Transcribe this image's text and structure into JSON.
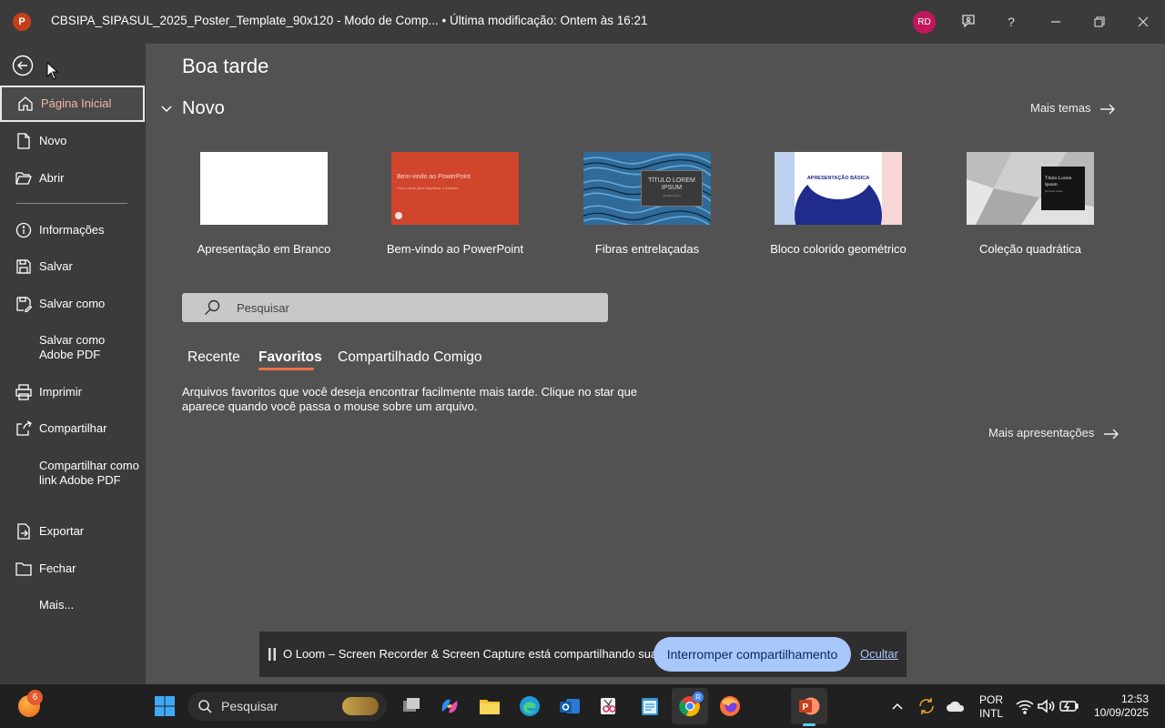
{
  "titlebar": {
    "app_icon_letter": "P",
    "title": "CBSIPA_SIPASUL_2025_Poster_Template_90x120  -  Modo de Comp...  •  Última modificação: Ontem às 16:21",
    "avatar": "RD",
    "help": "?"
  },
  "nav": {
    "items": [
      {
        "label": "Página Inicial",
        "icon": "home-icon"
      },
      {
        "label": "Novo",
        "icon": "new-document-icon"
      },
      {
        "label": "Abrir",
        "icon": "folder-open-icon"
      },
      {
        "label": "Informações",
        "icon": "info-icon"
      },
      {
        "label": "Salvar",
        "icon": "save-icon"
      },
      {
        "label": "Salvar como",
        "icon": "save-as-icon"
      },
      {
        "label": "Salvar como Adobe PDF",
        "icon": ""
      },
      {
        "label": "Imprimir",
        "icon": "print-icon"
      },
      {
        "label": "Compartilhar",
        "icon": "share-icon"
      },
      {
        "label": "Compartilhar como link Adobe PDF",
        "icon": ""
      },
      {
        "label": "Exportar",
        "icon": "export-icon"
      },
      {
        "label": "Fechar",
        "icon": "folder-close-icon"
      },
      {
        "label": "Mais...",
        "icon": ""
      }
    ]
  },
  "main": {
    "greeting": "Boa tarde",
    "section": "Novo",
    "more_themes": "Mais temas",
    "templates": [
      {
        "label": "Apresentação em Branco"
      },
      {
        "label": "Bem-vindo ao PowerPoint",
        "thumb_title": "Bem-vindo ao PowerPoint",
        "thumb_sub": "Cinco dicas para simplificar o trabalho"
      },
      {
        "label": "Fibras entrelaçadas",
        "thumb_title": "TÍTULO LOREM IPSUM",
        "thumb_sub": "Sit Dolor Amet"
      },
      {
        "label": "Bloco colorido geométrico",
        "thumb_title": "APRESENTAÇÃO BÁSICA"
      },
      {
        "label": "Coleção quadrática",
        "thumb_title": "Título Lorem Ipsum",
        "thumb_sub": "Sit Dolor Amet"
      }
    ],
    "search_placeholder": "Pesquisar",
    "tabs": [
      "Recente",
      "Favoritos",
      "Compartilhado Comigo"
    ],
    "active_tab": "Favoritos",
    "empty_message": "Arquivos favoritos que você deseja encontrar facilmente mais tarde. Clique no star que aparece quando você passa o mouse sobre um arquivo.",
    "more_presentations": "Mais apresentações"
  },
  "banner": {
    "message": "O Loom – Screen Recorder & Screen Capture está compartilhando sua tela.",
    "stop_button": "Interromper compartilhamento",
    "hide_link": "Ocultar"
  },
  "taskbar": {
    "notification_count": "6",
    "search_label": "Pesquisar",
    "lang_line1": "POR",
    "lang_line2": "INTL",
    "time": "12:53",
    "date": "10/09/2025",
    "chrome_badge": "R"
  },
  "colors": {
    "accent": "#f07048",
    "powerpoint": "#c43e1c",
    "stop_button": "#a8c7fa"
  }
}
